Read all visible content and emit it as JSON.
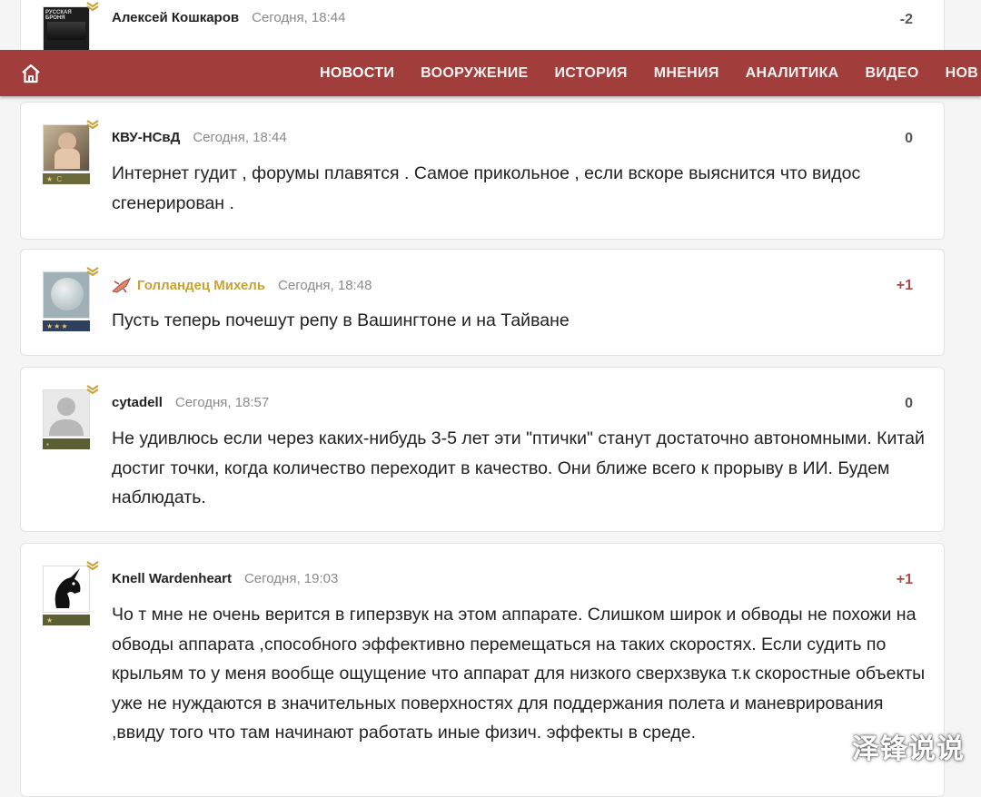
{
  "nav": {
    "items": [
      "НОВОСТИ",
      "ВООРУЖЕНИЕ",
      "ИСТОРИЯ",
      "МНЕНИЯ",
      "АНАЛИТИКА",
      "ВИДЕО",
      "НОВ"
    ]
  },
  "comments": [
    {
      "author": "Алексей Кошкаров",
      "time": "Сегодня, 18:44",
      "score": "-2",
      "text": ""
    },
    {
      "author": "КВУ-НСвД",
      "time": "Сегодня, 18:44",
      "score": "0",
      "text": "Интернет гудит , форумы плавятся . Самое прикольное , если вскоре выяснится что видос сгенерирован ."
    },
    {
      "author": "Голландец Михель",
      "time": "Сегодня, 18:48",
      "score": "+1",
      "text": "Пусть теперь почешут репу в Вашингтоне и на Тайване"
    },
    {
      "author": "cytadell",
      "time": "Сегодня, 18:57",
      "score": "0",
      "text": "Не удивлюсь если через каких-нибудь 3-5 лет эти \"птички\" станут достаточно автономными. Китай достиг точки, когда количество переходит в качество. Они ближе всего к прорыву в ИИ. Будем наблюдать."
    },
    {
      "author": "Knell Wardenheart",
      "time": "Сегодня, 19:03",
      "score": "+1",
      "text": "Чо т мне не очень верится в гиперзвук на этом аппарате. Слишком широк и обводы не похожи на обводы аппарата ,способного эффективно перемещаться на таких скоростях. Если судить по крыльям то у меня вообще ощущение что аппарат для низкого сверхзвука т.к скоростные объекты уже не нуждаются в значительных поверхностях для поддержания полета и маневрирования ,ввиду того что там начинают работать иные физич. эффекты в среде."
    }
  ],
  "watermark": "泽锋说说",
  "colors": {
    "nav_bg": "#a13d3b",
    "positive_score": "#a94a45",
    "gold_author": "#c9a233"
  }
}
